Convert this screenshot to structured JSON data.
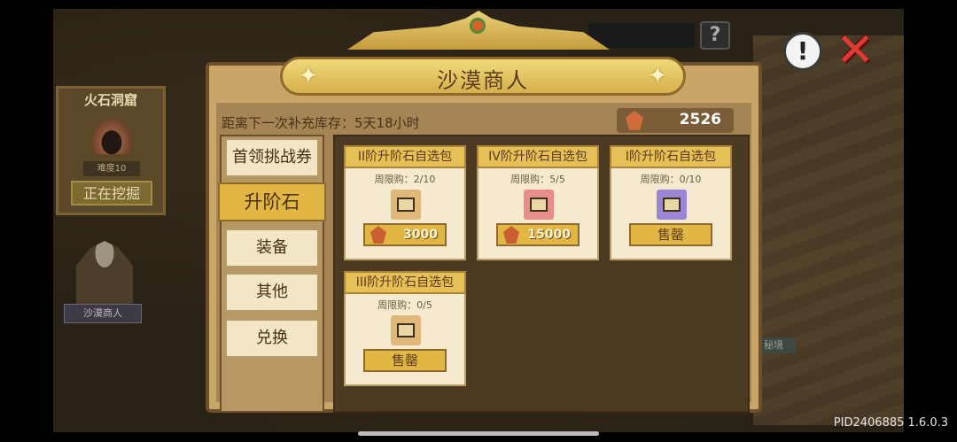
{
  "world": {
    "cave_title": "火石洞窟",
    "cave_level": "难度10",
    "cave_status_button": "正在挖掘",
    "merchant_label": "沙漠商人",
    "secret_label": "秘境"
  },
  "top_right": {
    "help_symbol": "?",
    "warning_symbol": "!",
    "close_symbol": "✕"
  },
  "shop": {
    "title": "沙漠商人",
    "restock_text": "距离下一次补充库存：5天18小时",
    "currency_amount": "2526",
    "tabs": [
      {
        "label": "首领挑战券",
        "active": false
      },
      {
        "label": "升阶石",
        "active": true
      },
      {
        "label": "装备",
        "active": false
      },
      {
        "label": "其他",
        "active": false
      },
      {
        "label": "兑换",
        "active": false
      }
    ],
    "items": [
      {
        "title": "II阶升阶石自选包",
        "limit": "周限购：2/10",
        "button": "3000",
        "priced": true,
        "icon_color": "#e0b97a"
      },
      {
        "title": "IV阶升阶石自选包",
        "limit": "周限购：5/5",
        "button": "15000",
        "priced": true,
        "icon_color": "#e88c8c"
      },
      {
        "title": "I阶升阶石自选包",
        "limit": "周限购：0/10",
        "button": "售罄",
        "priced": false,
        "icon_color": "#9b86d6"
      },
      {
        "title": "III阶升阶石自选包",
        "limit": "周限购：0/5",
        "button": "售罄",
        "priced": false,
        "icon_color": "#e0b97a"
      }
    ]
  },
  "footer": "PID2406885 1.6.0.3"
}
